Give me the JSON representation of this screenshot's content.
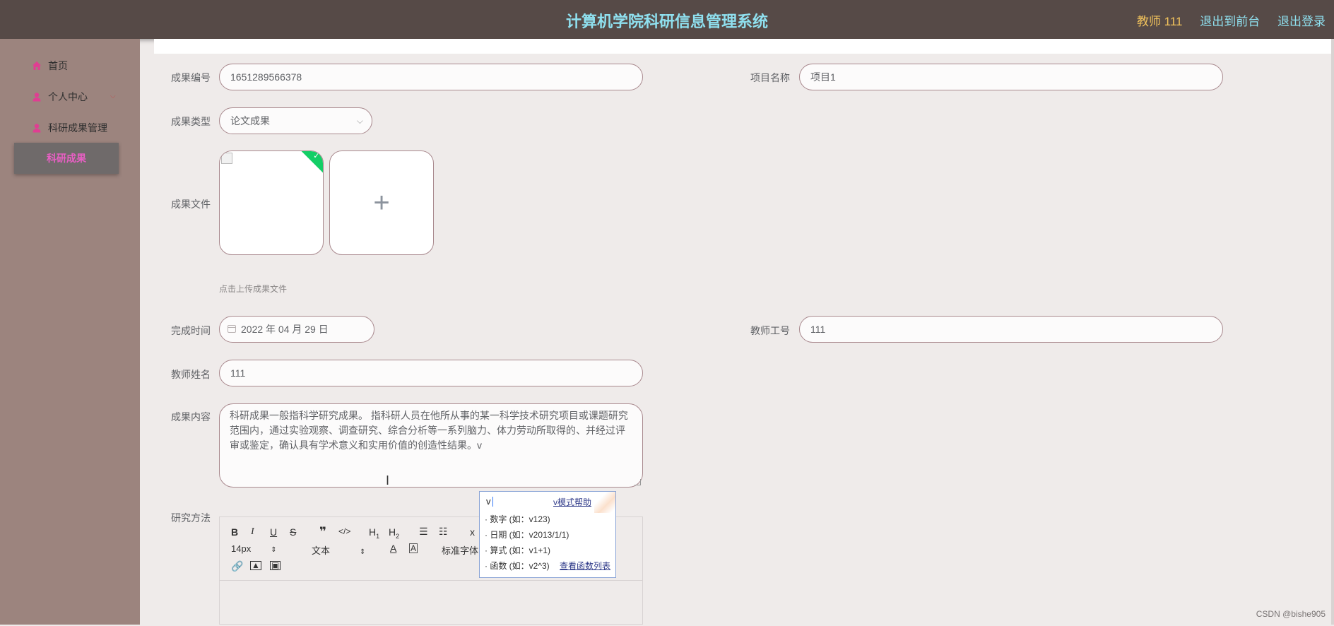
{
  "header": {
    "title": "计算机学院科研信息管理系统",
    "user": "教师 111",
    "back_to_front": "退出到前台",
    "logout": "退出登录"
  },
  "sidebar": {
    "items": [
      {
        "label": "首页",
        "icon": "home-icon"
      },
      {
        "label": "个人中心",
        "icon": "user-icon"
      },
      {
        "label": "科研成果管理",
        "icon": "user-icon"
      }
    ],
    "active": "科研成果"
  },
  "form": {
    "result_no_label": "成果编号",
    "result_no_value": "1651289566378",
    "project_name_label": "项目名称",
    "project_name_value": "项目1",
    "result_type_label": "成果类型",
    "result_type_value": "论文成果",
    "result_file_label": "成果文件",
    "upload_hint": "点击上传成果文件",
    "finish_time_label": "完成时间",
    "finish_time_value": "2022 年 04 月 29 日",
    "teacher_no_label": "教师工号",
    "teacher_no_value": "111",
    "teacher_name_label": "教师姓名",
    "teacher_name_value": "111",
    "content_label": "成果内容",
    "content_value": "科研成果一般指科学研究成果。 指科研人员在他所从事的某一科学技术研究项目或课题研究范围内，通过实验观察、调查研究、综合分析等一系列脑力、体力劳动所取得的、并经过评审或鉴定，确认具有学术意义和实用价值的创造性结果。v",
    "method_label": "研究方法"
  },
  "editor": {
    "font_size": "14px",
    "paragraph": "文本",
    "font_family": "标准字体"
  },
  "popup": {
    "typed": "v",
    "help": "v模式帮助",
    "line1": "· 数字 (如：v123)",
    "line2": "· 日期 (如：v2013/1/1)",
    "line3": "· 算式 (如：v1+1)",
    "line4": "· 函数 (如：v2^3)",
    "fn_list": "查看函数列表"
  },
  "watermark": "CSDN @bishe905",
  "colors": {
    "topbar": "#564a47",
    "title": "#8fe0ef",
    "user": "#f2c35c",
    "sidebar": "#9c847e",
    "active_text": "#e85fc4",
    "success_badge": "#13ce66"
  }
}
